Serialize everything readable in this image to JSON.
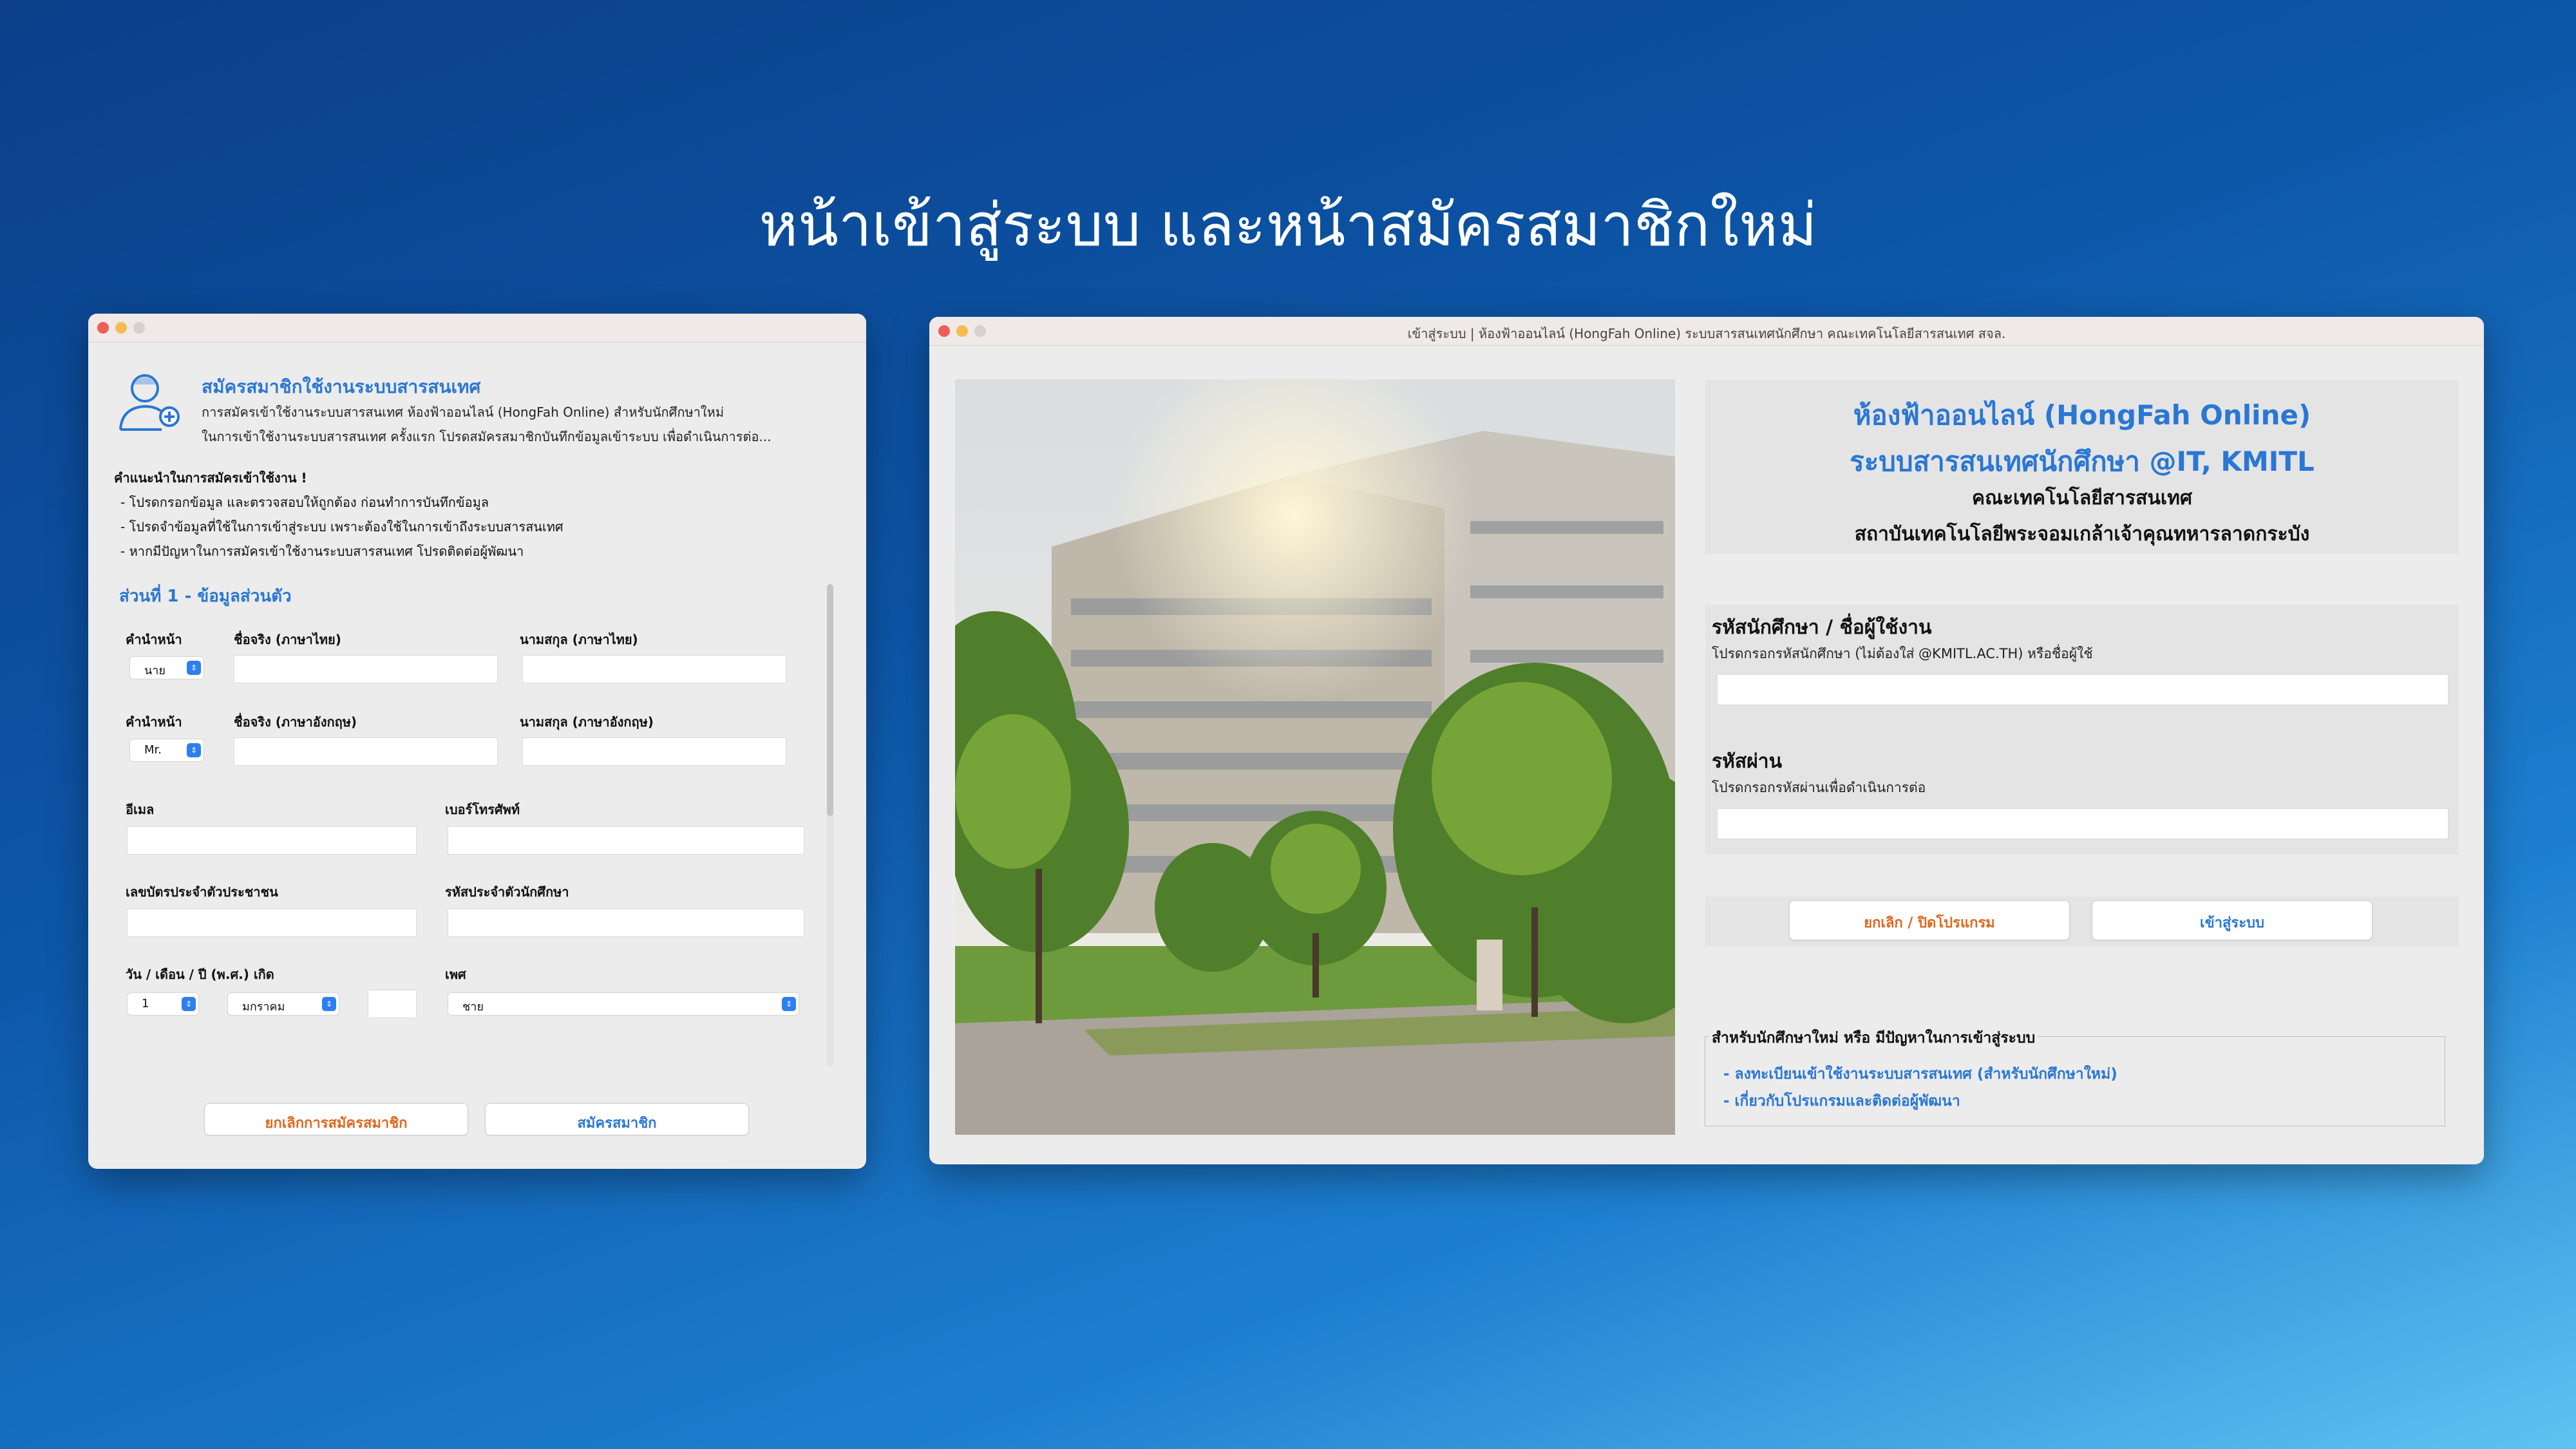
{
  "headline": "หน้าเข้าสู่ระบบ และหน้าสมัครสมาชิกใหม่",
  "registration": {
    "title": "สมัครสมาชิกใช้งานระบบสารสนเทศ",
    "intro_line1": "การสมัครเข้าใช้งานระบบสารสนเทศ ห้องฟ้าออนไลน์ (HongFah Online) สำหรับนักศึกษาใหม่",
    "intro_line2": "ในการเข้าใช้งานระบบสารสนเทศ ครั้งแรก โปรดสมัครสมาชิกบันทึกข้อมูลเข้าระบบ เพื่อดำเนินการต่อ...",
    "advice_heading": "คำแนะนำในการสมัครเข้าใช้งาน !",
    "advice_lines": [
      "- โปรดกรอกข้อมูล และตรวจสอบให้ถูกต้อง ก่อนทำการบันทึกข้อมูล",
      "- โปรดจำข้อมูลที่ใช้ในการเข้าสู่ระบบ เพราะต้องใช้ในการเข้าถึงระบบสารสนเทศ",
      "- หากมีปัญหาในการสมัครเข้าใช้งานระบบสารสนเทศ โปรดติดต่อผู้พัฒนา"
    ],
    "section1_title": "ส่วนที่ 1 - ข้อมูลส่วนตัว",
    "labels": {
      "prefix_th": "คำนำหน้า",
      "firstname_th": "ชื่อจริง (ภาษาไทย)",
      "lastname_th": "นามสกุล (ภาษาไทย)",
      "prefix_en": "คำนำหน้า",
      "firstname_en": "ชื่อจริง (ภาษาอังกฤษ)",
      "lastname_en": "นามสกุล (ภาษาอังกฤษ)",
      "email": "อีเมล",
      "phone": "เบอร์โทรศัพท์",
      "national_id": "เลขบัตรประจำตัวประชาชน",
      "student_id": "รหัสประจำตัวนักศึกษา",
      "birthdate": "วัน / เดือน / ปี (พ.ศ.) เกิด",
      "gender": "เพศ"
    },
    "values": {
      "prefix_th": "นาย",
      "prefix_en": "Mr.",
      "day": "1",
      "month": "มกราคม",
      "gender": "ชาย"
    },
    "cancel_button": "ยกเลิกการสมัครสมาชิก",
    "submit_button": "สมัครสมาชิก"
  },
  "login": {
    "window_title": "เข้าสู่ระบบ | ห้องฟ้าออนไลน์ (HongFah Online) ระบบสารสนเทศนักศึกษา คณะเทคโนโลยีสารสนเทศ สจล.",
    "heading1": "ห้องฟ้าออนไลน์ (HongFah Online)",
    "heading2": "ระบบสารสนเทศนักศึกษา @IT, KMITL",
    "faculty": "คณะเทคโนโลยีสารสนเทศ",
    "institute": "สถาบันเทคโนโลยีพระจอมเกล้าเจ้าคุณทหารลาดกระบัง",
    "username_label": "รหัสนักศึกษา / ชื่อผู้ใช้งาน",
    "username_hint": "โปรดกรอกรหัสนักศึกษา (ไม่ต้องใส่ @KMITL.AC.TH) หรือชื่อผู้ใช้",
    "password_label": "รหัสผ่าน",
    "password_hint": "โปรดกรอกรหัสผ่านเพื่อดำเนินการต่อ",
    "cancel_button": "ยกเลิก / ปิดโปรแกรม",
    "login_button": "เข้าสู่ระบบ",
    "help_title": "สำหรับนักศึกษาใหม่ หรือ มีปัญหาในการเข้าสู่ระบบ",
    "help_link1": "- ลงทะเบียนเข้าใช้งานระบบสารสนเทศ (สำหรับนักศึกษาใหม่)",
    "help_link2": "- เกี่ยวกับโปรแกรมและติดต่อผู้พัฒนา"
  },
  "colors": {
    "accent_blue": "#2a77d4",
    "accent_orange": "#e0661d",
    "select_blue": "#2d7ef1"
  },
  "icons": [
    "user-add-icon",
    "chevron-updown-icon"
  ]
}
